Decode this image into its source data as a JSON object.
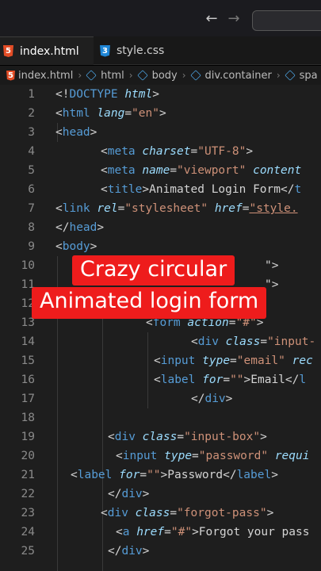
{
  "tabs": [
    {
      "icon": "5",
      "label": "index.html"
    },
    {
      "icon": "3",
      "label": "style.css"
    }
  ],
  "breadcrumb": [
    "index.html",
    "html",
    "body",
    "div.container",
    "spa"
  ],
  "caption": [
    "Crazy circular",
    "Animated login form"
  ],
  "lines": [
    {
      "n": "1",
      "indent": 0,
      "parts": [
        [
          "p",
          "<!"
        ],
        [
          "t",
          "DOCTYPE"
        ],
        [
          "p",
          " "
        ],
        [
          "a",
          "html"
        ],
        [
          "p",
          ">"
        ]
      ]
    },
    {
      "n": "2",
      "indent": 0,
      "parts": [
        [
          "p",
          "<"
        ],
        [
          "t",
          "html"
        ],
        [
          "p",
          " "
        ],
        [
          "a",
          "lang"
        ],
        [
          "p",
          "="
        ],
        [
          "s",
          "\"en\""
        ],
        [
          "p",
          ">"
        ]
      ]
    },
    {
      "n": "3",
      "indent": 0,
      "parts": [
        [
          "p",
          "<"
        ],
        [
          "t",
          "head"
        ],
        [
          "p",
          ">"
        ]
      ]
    },
    {
      "n": "4",
      "indent": 57,
      "parts": [
        [
          "p",
          "<"
        ],
        [
          "t",
          "meta"
        ],
        [
          "p",
          " "
        ],
        [
          "a",
          "charset"
        ],
        [
          "p",
          "="
        ],
        [
          "s",
          "\"UTF-8\""
        ],
        [
          "p",
          ">"
        ]
      ]
    },
    {
      "n": "5",
      "indent": 57,
      "parts": [
        [
          "p",
          "<"
        ],
        [
          "t",
          "meta"
        ],
        [
          "p",
          " "
        ],
        [
          "a",
          "name"
        ],
        [
          "p",
          "="
        ],
        [
          "s",
          "\"viewport\""
        ],
        [
          "p",
          " "
        ],
        [
          "a",
          "content"
        ]
      ]
    },
    {
      "n": "6",
      "indent": 57,
      "parts": [
        [
          "p",
          "<"
        ],
        [
          "t",
          "title"
        ],
        [
          "p",
          ">Animated Login Form</"
        ],
        [
          "t",
          "t"
        ]
      ]
    },
    {
      "n": "7",
      "indent": 0,
      "parts": [
        [
          "p",
          "<"
        ],
        [
          "t",
          "link"
        ],
        [
          "p",
          " "
        ],
        [
          "a",
          "rel"
        ],
        [
          "p",
          "="
        ],
        [
          "s",
          "\"stylesheet\""
        ],
        [
          "p",
          " "
        ],
        [
          "a",
          "href"
        ],
        [
          "p",
          "="
        ],
        [
          "st",
          "\"style."
        ]
      ]
    },
    {
      "n": "8",
      "indent": 0,
      "parts": [
        [
          "p",
          "</"
        ],
        [
          "t",
          "head"
        ],
        [
          "p",
          ">"
        ]
      ]
    },
    {
      "n": "9",
      "indent": 0,
      "parts": [
        [
          "p",
          "<"
        ],
        [
          "t",
          "body"
        ],
        [
          "p",
          ">"
        ]
      ]
    },
    {
      "n": "10",
      "indent": 264,
      "parts": [
        [
          "p",
          "\">"
        ]
      ]
    },
    {
      "n": "11",
      "indent": 264,
      "parts": [
        [
          "p",
          "\">"
        ]
      ]
    },
    {
      "n": "12",
      "indent": 0,
      "parts": []
    },
    {
      "n": "13",
      "indent": 114,
      "parts": [
        [
          "p",
          "<"
        ],
        [
          "t",
          "form"
        ],
        [
          "p",
          " "
        ],
        [
          "a",
          "action"
        ],
        [
          "p",
          "="
        ],
        [
          "s",
          "\"#\""
        ],
        [
          "p",
          ">"
        ]
      ]
    },
    {
      "n": "14",
      "indent": 171,
      "parts": [
        [
          "p",
          "<"
        ],
        [
          "t",
          "div"
        ],
        [
          "p",
          " "
        ],
        [
          "a",
          "class"
        ],
        [
          "p",
          "="
        ],
        [
          "s",
          "\"input-"
        ]
      ]
    },
    {
      "n": "15",
      "indent": 124,
      "parts": [
        [
          "p",
          "<"
        ],
        [
          "t",
          "input"
        ],
        [
          "p",
          " "
        ],
        [
          "a",
          "type"
        ],
        [
          "p",
          "="
        ],
        [
          "s",
          "\"email\""
        ],
        [
          "p",
          " "
        ],
        [
          "a",
          "rec"
        ]
      ]
    },
    {
      "n": "16",
      "indent": 124,
      "parts": [
        [
          "p",
          "<"
        ],
        [
          "t",
          "label"
        ],
        [
          "p",
          " "
        ],
        [
          "a",
          "for"
        ],
        [
          "p",
          "="
        ],
        [
          "s",
          "\"\""
        ],
        [
          "p",
          ">Email</"
        ],
        [
          "t",
          "l"
        ]
      ]
    },
    {
      "n": "17",
      "indent": 171,
      "parts": [
        [
          "p",
          "</"
        ],
        [
          "t",
          "div"
        ],
        [
          "p",
          ">"
        ]
      ]
    },
    {
      "n": "18",
      "indent": 0,
      "parts": []
    },
    {
      "n": "19",
      "indent": 66,
      "parts": [
        [
          "p",
          "<"
        ],
        [
          "t",
          "div"
        ],
        [
          "p",
          " "
        ],
        [
          "a",
          "class"
        ],
        [
          "p",
          "="
        ],
        [
          "s",
          "\"input-box\""
        ],
        [
          "p",
          ">"
        ]
      ]
    },
    {
      "n": "20",
      "indent": 76,
      "parts": [
        [
          "p",
          "<"
        ],
        [
          "t",
          "input"
        ],
        [
          "p",
          " "
        ],
        [
          "a",
          "type"
        ],
        [
          "p",
          "="
        ],
        [
          "s",
          "\"password\""
        ],
        [
          "p",
          " "
        ],
        [
          "a",
          "requi"
        ]
      ]
    },
    {
      "n": "21",
      "indent": 19,
      "parts": [
        [
          "p",
          "<"
        ],
        [
          "t",
          "label"
        ],
        [
          "p",
          " "
        ],
        [
          "a",
          "for"
        ],
        [
          "p",
          "="
        ],
        [
          "s",
          "\"\""
        ],
        [
          "p",
          ">Password</"
        ],
        [
          "t",
          "label"
        ],
        [
          "p",
          ">"
        ]
      ]
    },
    {
      "n": "22",
      "indent": 66,
      "parts": [
        [
          "p",
          "</"
        ],
        [
          "t",
          "div"
        ],
        [
          "p",
          ">"
        ]
      ]
    },
    {
      "n": "23",
      "indent": 57,
      "parts": [
        [
          "p",
          "<"
        ],
        [
          "t",
          "div"
        ],
        [
          "p",
          " "
        ],
        [
          "a",
          "class"
        ],
        [
          "p",
          "="
        ],
        [
          "s",
          "\"forgot-pass\""
        ],
        [
          "p",
          ">"
        ]
      ]
    },
    {
      "n": "24",
      "indent": 76,
      "parts": [
        [
          "p",
          "<"
        ],
        [
          "t",
          "a"
        ],
        [
          "p",
          " "
        ],
        [
          "a",
          "href"
        ],
        [
          "p",
          "="
        ],
        [
          "s",
          "\"#\""
        ],
        [
          "p",
          ">Forgot your pass"
        ]
      ]
    },
    {
      "n": "25",
      "indent": 66,
      "parts": [
        [
          "p",
          "</"
        ],
        [
          "t",
          "div"
        ],
        [
          "p",
          ">"
        ]
      ]
    }
  ]
}
